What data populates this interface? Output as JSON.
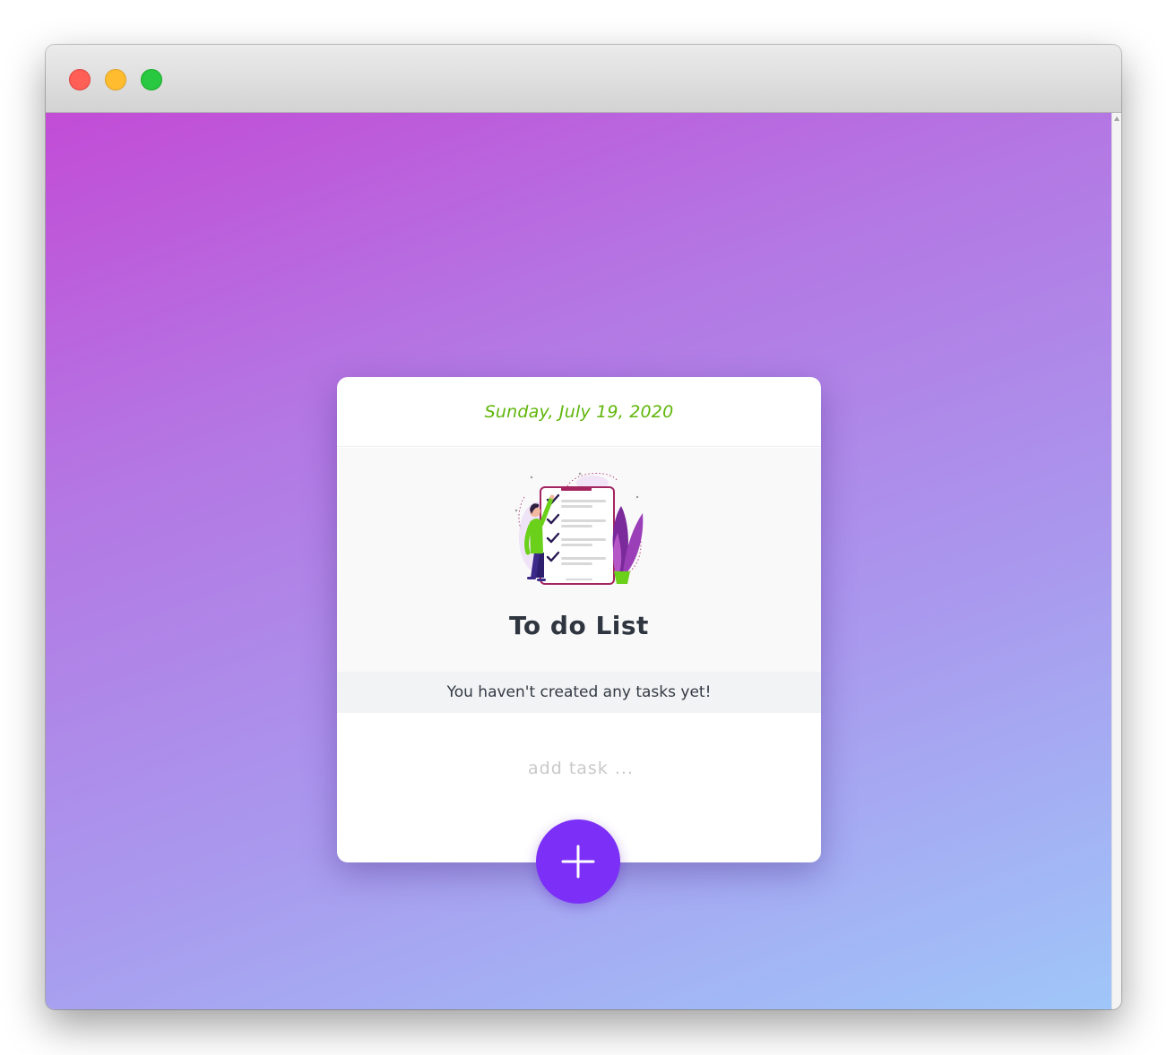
{
  "window": {
    "controls": [
      "close",
      "minimize",
      "zoom"
    ]
  },
  "card": {
    "date": "Sunday, July 19, 2020",
    "title": "To do List",
    "empty_message": "You haven't created any tasks yet!",
    "input": {
      "placeholder": "add task ...",
      "value": ""
    },
    "add_button": {
      "icon": "plus-icon"
    }
  },
  "colors": {
    "date_text": "#5fb60a",
    "title_text": "#2f3640",
    "add_button": "#7b2ff7",
    "background_start": "#c24cd6",
    "background_end": "#9fc6f9"
  }
}
